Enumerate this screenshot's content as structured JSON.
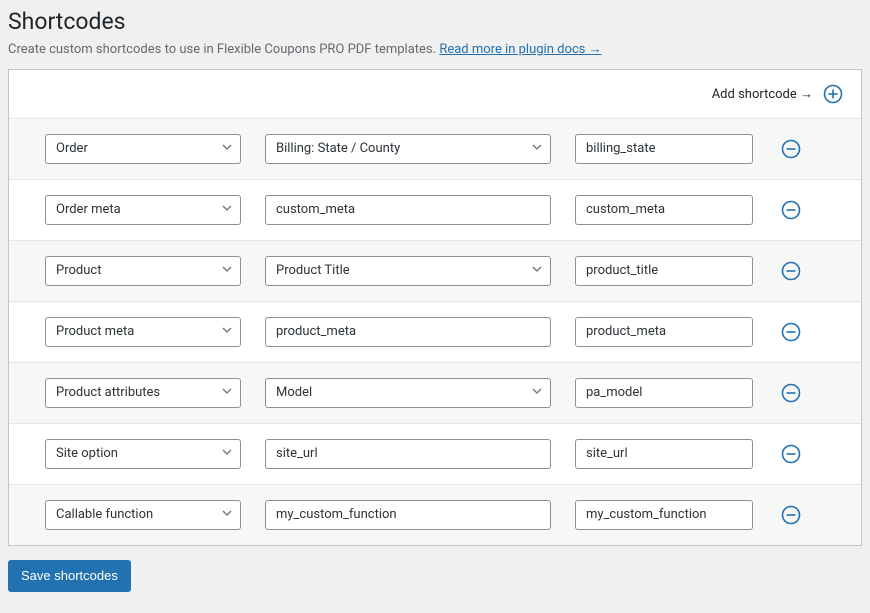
{
  "page": {
    "title": "Shortcodes",
    "description_text": "Create custom shortcodes to use in Flexible Coupons PRO PDF templates. ",
    "docs_link_text": "Read more in plugin docs →"
  },
  "actions": {
    "add_label": "Add shortcode →",
    "save_label": "Save shortcodes"
  },
  "rows": [
    {
      "type": "Order",
      "field_is_select": true,
      "field": "Billing: State / County",
      "value": "billing_state"
    },
    {
      "type": "Order meta",
      "field_is_select": false,
      "field": "custom_meta",
      "value": "custom_meta"
    },
    {
      "type": "Product",
      "field_is_select": true,
      "field": "Product Title",
      "value": "product_title"
    },
    {
      "type": "Product meta",
      "field_is_select": false,
      "field": "product_meta",
      "value": "product_meta"
    },
    {
      "type": "Product attributes",
      "field_is_select": true,
      "field": "Model",
      "value": "pa_model"
    },
    {
      "type": "Site option",
      "field_is_select": false,
      "field": "site_url",
      "value": "site_url"
    },
    {
      "type": "Callable function",
      "field_is_select": false,
      "field": "my_custom_function",
      "value": "my_custom_function"
    }
  ]
}
